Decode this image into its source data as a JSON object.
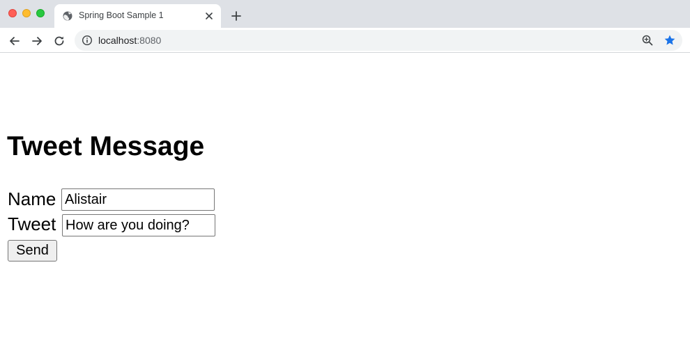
{
  "browser": {
    "tab": {
      "title": "Spring Boot Sample 1",
      "favicon": "globe-icon"
    },
    "address_bar": {
      "host": "localhost",
      "port": ":8080"
    },
    "icons": {
      "back": "arrow-left-icon",
      "forward": "arrow-right-icon",
      "reload": "reload-icon",
      "site_info": "info-icon",
      "zoom": "zoom-in-icon",
      "bookmark": "star-icon",
      "new_tab": "plus-icon",
      "close_tab": "close-icon"
    },
    "colors": {
      "tabstrip": "#dee1e6",
      "omnibox": "#f1f3f4",
      "star": "#1a73e8"
    }
  },
  "page": {
    "heading": "Tweet Message",
    "form": {
      "name_label": "Name",
      "name_value": "Alistair",
      "tweet_label": "Tweet",
      "tweet_value": "How are you doing?",
      "submit_label": "Send"
    }
  }
}
